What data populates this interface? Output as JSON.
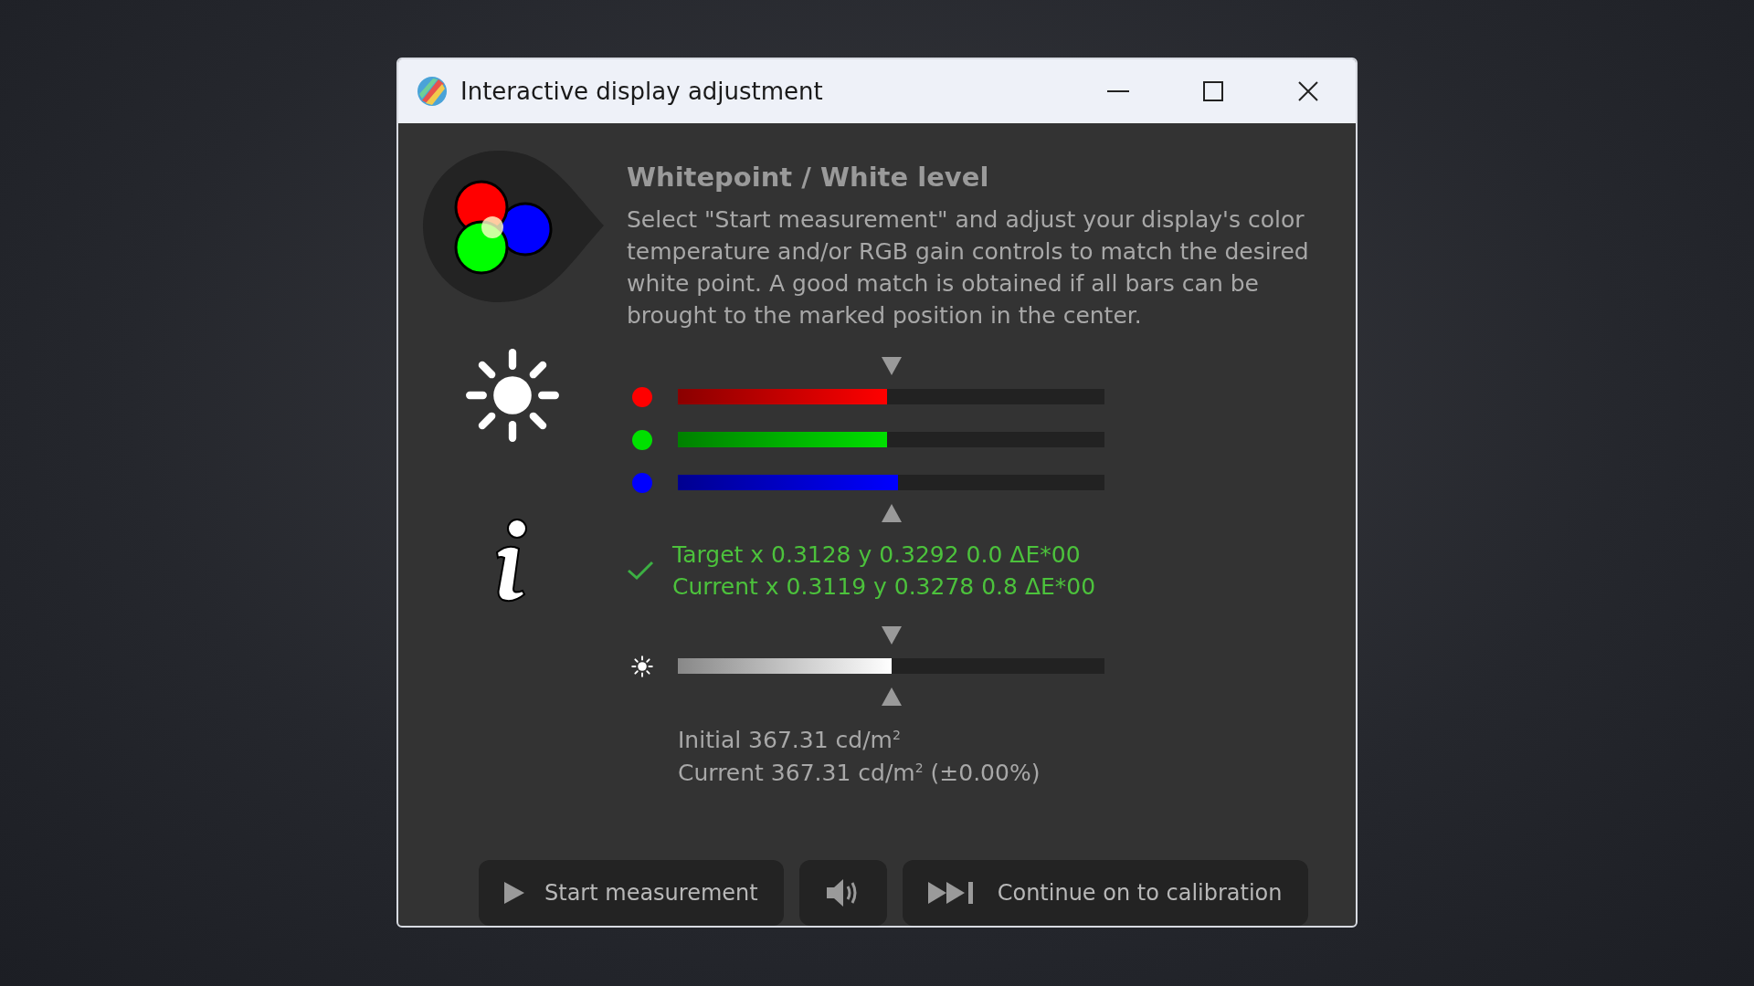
{
  "window": {
    "title": "Interactive display adjustment"
  },
  "heading": "Whitepoint / White level",
  "description": "Select \"Start measurement\" and adjust your display's color temperature and/or RGB gain controls to match the desired white point. A good match is obtained if all bars can be brought to the marked position in the center.",
  "channels": [
    {
      "color": "#ff0000",
      "level": 0.49
    },
    {
      "color": "#00e000",
      "level": 0.49
    },
    {
      "color": "#0000ff",
      "level": 0.515
    }
  ],
  "status": {
    "ok": true,
    "lines": [
      "Target x 0.3128 y 0.3292 0.0 ΔE*00",
      "Current x 0.3119 y 0.3278 0.8 ΔE*00"
    ]
  },
  "luminance": {
    "level": 0.5,
    "lines": [
      "Initial 367.31 cd/m$^{2}$",
      "Current 367.31 cd/m$^{2}$ (±0.00%)"
    ]
  },
  "buttons": [
    {
      "kind": "play",
      "label": "Start measurement"
    },
    {
      "kind": "sound"
    },
    {
      "kind": "skip",
      "label": "Continue on to calibration"
    }
  ]
}
